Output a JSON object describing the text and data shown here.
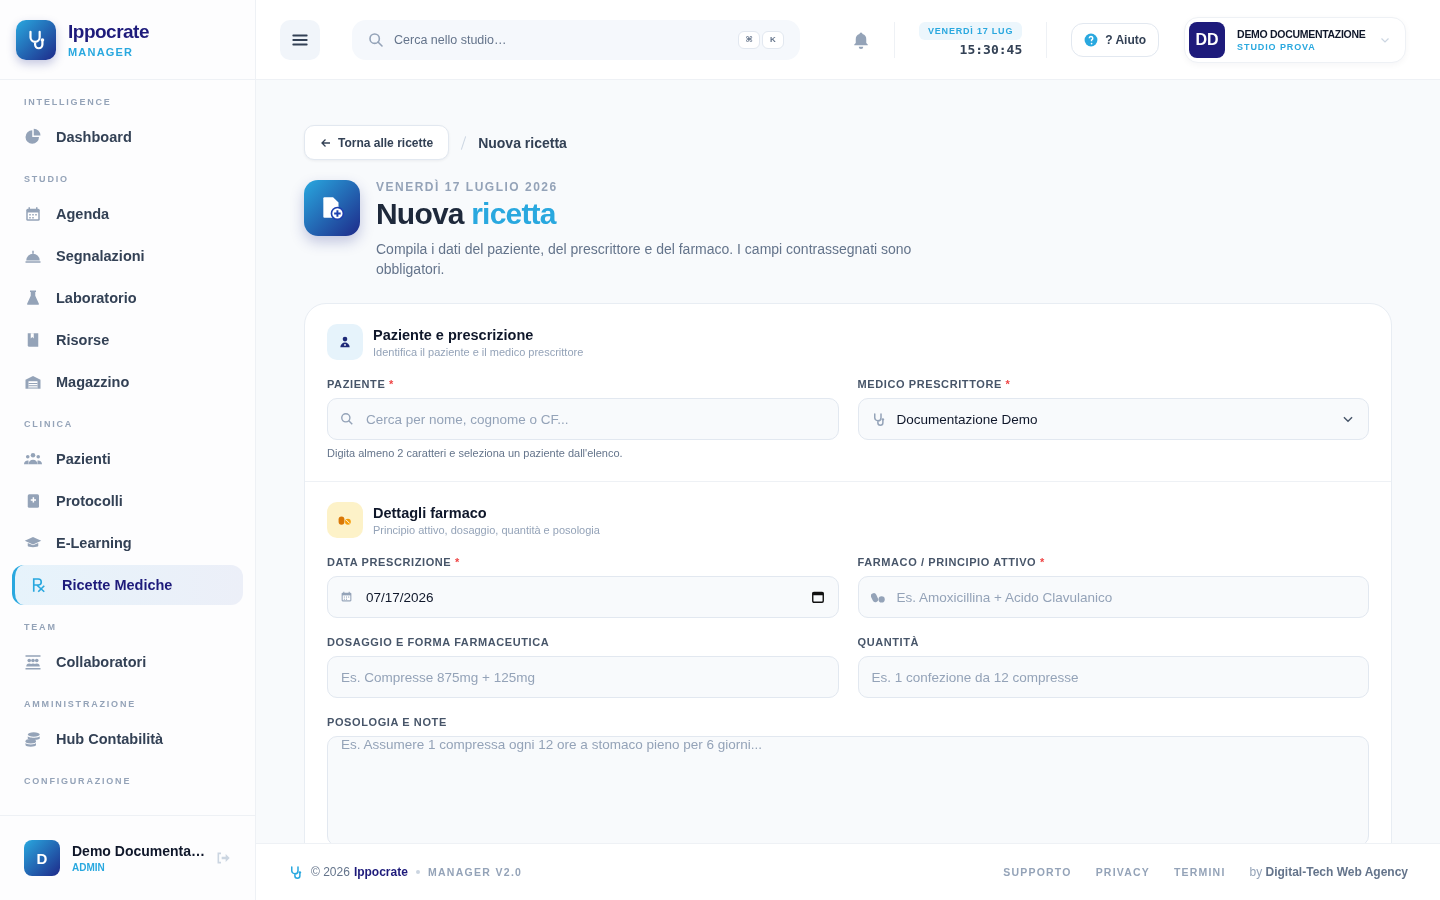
{
  "brand": {
    "name": "Ippocrate",
    "subtitle": "MANAGER"
  },
  "sidebar": {
    "sections": [
      {
        "title": "INTELLIGENCE",
        "items": [
          {
            "label": "Dashboard",
            "selected": false
          }
        ]
      },
      {
        "title": "STUDIO",
        "items": [
          {
            "label": "Agenda",
            "selected": false
          },
          {
            "label": "Segnalazioni",
            "selected": false
          },
          {
            "label": "Laboratorio",
            "selected": false
          },
          {
            "label": "Risorse",
            "selected": false
          },
          {
            "label": "Magazzino",
            "selected": false
          }
        ]
      },
      {
        "title": "CLINICA",
        "items": [
          {
            "label": "Pazienti",
            "selected": false
          },
          {
            "label": "Protocolli",
            "selected": false
          },
          {
            "label": "E-Learning",
            "selected": false
          },
          {
            "label": "Ricette Mediche",
            "selected": true
          }
        ]
      },
      {
        "title": "TEAM",
        "items": [
          {
            "label": "Collaboratori",
            "selected": false
          }
        ]
      },
      {
        "title": "AMMINISTRAZIONE",
        "items": [
          {
            "label": "Hub Contabilità",
            "selected": false
          }
        ]
      },
      {
        "title": "CONFIGURAZIONE"
      }
    ],
    "user": {
      "initial": "D",
      "name": "Demo Documenta…",
      "role": "ADMIN"
    }
  },
  "topbar": {
    "search": {
      "placeholder": "Cerca nello studio…"
    },
    "shortcut_keys": [
      "⌘",
      "K"
    ],
    "date_badge": "VENERDÌ 17 LUG",
    "clock": "15:30:45",
    "help_button": "? Aiuto",
    "account": {
      "initials": "DD",
      "name": "DEMO DOCUMENTAZIONE",
      "studio": "STUDIO PROVA"
    }
  },
  "breadcrumb": {
    "back_button": "Torna alle ricette",
    "current": "Nuova ricetta"
  },
  "page": {
    "date": "VENERDÌ 17 LUGLIO 2026",
    "title": "Nuova",
    "title_highlight": "ricetta",
    "description": "Compila i dati del paziente, del prescrittore e del farmaco. I campi contrassegnati sono obbligatori."
  },
  "sections": [
    {
      "title": "Paziente e prescrizione",
      "subtitle": "Identifica il paziente e il medico prescrittore",
      "fields": [
        {
          "kind": "search",
          "label": "PAZIENTE",
          "required_mark": "*",
          "placeholder": "Cerca per nome, cognome o CF...",
          "hint": "Digita almeno 2 caratteri e seleziona un paziente dall'elenco."
        },
        {
          "kind": "select",
          "label": "MEDICO PRESCRITTORE",
          "required_mark": "*",
          "value": "Documentazione Demo"
        }
      ]
    },
    {
      "title": "Dettagli farmaco",
      "subtitle": "Principio attivo, dosaggio, quantità e posologia",
      "fields": [
        {
          "kind": "date",
          "label": "DATA PRESCRIZIONE",
          "required_mark": "*",
          "value": "07/17/2026"
        },
        {
          "kind": "drug",
          "label": "FARMACO / PRINCIPIO ATTIVO",
          "required_mark": "*",
          "placeholder": "Es. Amoxicillina + Acido Clavulanico"
        },
        {
          "kind": "text",
          "label": "DOSAGGIO E FORMA FARMACEUTICA",
          "placeholder": "Es. Compresse 875mg + 125mg"
        },
        {
          "kind": "text",
          "label": "QUANTITÀ",
          "placeholder": "Es. 1 confezione da 12 compresse"
        },
        {
          "kind": "textarea",
          "label": "POSOLOGIA E NOTE",
          "placeholder": "Es. Assumere 1 compressa ogni 12 ore a stomaco pieno per 6 giorni..."
        }
      ]
    }
  ],
  "footer": {
    "copyright": "© 2026",
    "brand": "Ippocrate",
    "version": "MANAGER V2.0",
    "links": [
      "SUPPORTO",
      "PRIVACY",
      "TERMINI"
    ],
    "credit": "by",
    "agency": "Digital-Tech Web Agency"
  }
}
